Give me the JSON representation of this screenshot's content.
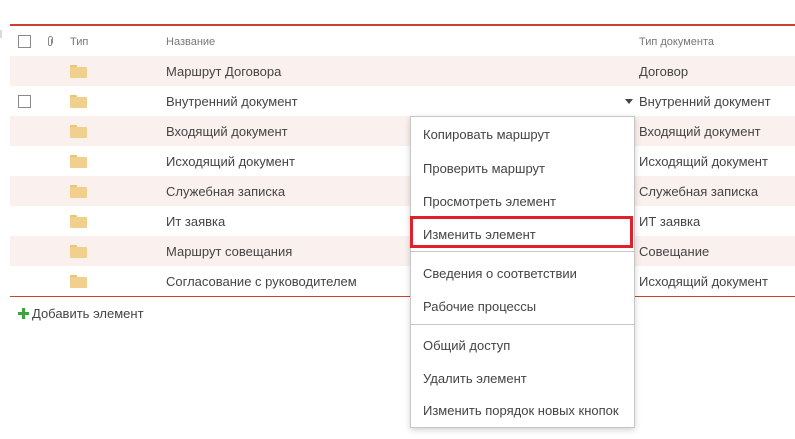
{
  "list": {
    "headers": {
      "type": "Тип",
      "name": "Название",
      "doc_type": "Тип документа"
    },
    "rows": [
      {
        "name": "Маршрут Договора",
        "doc_type": "Договор"
      },
      {
        "name": "Внутренний документ",
        "doc_type": "Внутренний документ"
      },
      {
        "name": "Входящий документ",
        "doc_type": "Входящий документ"
      },
      {
        "name": "Исходящий документ",
        "doc_type": "Исходящий документ"
      },
      {
        "name": "Служебная записка",
        "doc_type": "Служебная записка"
      },
      {
        "name": "Ит заявка",
        "doc_type": "ИТ заявка"
      },
      {
        "name": "Маршрут совещания",
        "doc_type": "Совещание"
      },
      {
        "name": "Согласование с руководителем",
        "doc_type": "Исходящий документ"
      }
    ],
    "add_item_label": "Добавить элемент"
  },
  "context_menu": {
    "items": [
      "Копировать маршрут",
      "Проверить маршрут",
      "Просмотреть элемент",
      "Изменить элемент",
      "Сведения о соответствии",
      "Рабочие процессы",
      "Общий доступ",
      "Удалить элемент",
      "Изменить порядок новых кнопок"
    ],
    "highlighted_item": "Изменить элемент"
  },
  "colors": {
    "accent_rule": "#c8432c",
    "alt_row": "#faf0ee",
    "highlight_border": "#e0202a",
    "folder": "#f1d08e",
    "plus": "#3aa53a"
  },
  "icons": {
    "attachment_header": "paperclip-icon",
    "row_type": "folder-icon",
    "add": "plus-icon",
    "row_menu": "chevron-down-icon"
  }
}
